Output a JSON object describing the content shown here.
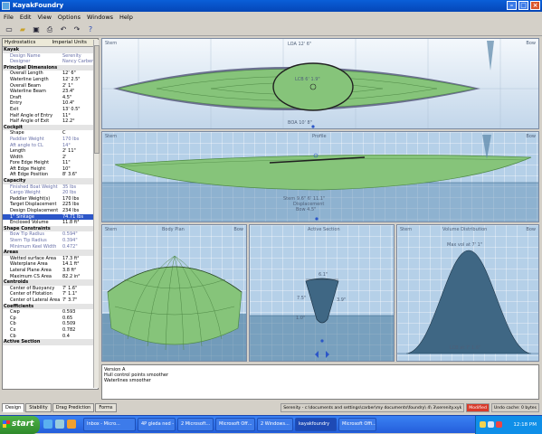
{
  "window": {
    "title": "KayakFoundry"
  },
  "menu": [
    "File",
    "Edit",
    "View",
    "Options",
    "Windows",
    "Help"
  ],
  "toolbar_icons": [
    "new-icon",
    "open-icon",
    "save-icon",
    "print-icon",
    "undo-icon",
    "redo-icon",
    "help-icon"
  ],
  "sidebar": {
    "header_left": "Hydrostatics",
    "header_right": "Imperial Units",
    "rows": [
      {
        "type": "cat",
        "name": "Kayak"
      },
      {
        "name": "Design Name",
        "value": "Serenity",
        "style": "dim"
      },
      {
        "name": "Designer",
        "value": "Nancy Carber",
        "style": "dim"
      },
      {
        "type": "cat",
        "name": "Principal Dimensions"
      },
      {
        "name": "Overall Length",
        "value": "12' 6\""
      },
      {
        "name": "Waterline Length",
        "value": "12' 2.5\""
      },
      {
        "name": "Overall Beam",
        "value": "2' 1\""
      },
      {
        "name": "Waterline Beam",
        "value": "23.4\""
      },
      {
        "name": "Draft",
        "value": "4.5\""
      },
      {
        "name": "Entry",
        "value": "10.4\""
      },
      {
        "name": "Exit",
        "value": "13' 0.5\""
      },
      {
        "name": "Half Angle of Entry",
        "value": "11°"
      },
      {
        "name": "Half Angle of Exit",
        "value": "12.2°"
      },
      {
        "type": "cat",
        "name": "Cockpit"
      },
      {
        "name": "Shape",
        "value": "C"
      },
      {
        "name": "Paddler Weight",
        "value": "170 lbs",
        "style": "dim"
      },
      {
        "name": "Aft angle to CL",
        "value": "14°",
        "style": "dim"
      },
      {
        "name": "Length",
        "value": "2' 11\""
      },
      {
        "name": "Width",
        "value": "2'"
      },
      {
        "name": "Fore Edge Height",
        "value": "11\""
      },
      {
        "name": "Aft Edge Height",
        "value": "10\""
      },
      {
        "name": "Aft Edge Position",
        "value": "8' 3.6\""
      },
      {
        "type": "cat",
        "name": "Capacity"
      },
      {
        "name": "Finished Boat Weight",
        "value": "35 lbs",
        "style": "dim"
      },
      {
        "name": "Cargo Weight",
        "value": "20 lbs",
        "style": "dim"
      },
      {
        "name": "Paddler Weight(s)",
        "value": "170 lbs"
      },
      {
        "name": "Target Displacement",
        "value": "225 lbs"
      },
      {
        "name": "Design Displacement",
        "value": "234 lbs"
      },
      {
        "name": "1\" Sinkage",
        "value": "74.71 lbs",
        "style": "hi"
      },
      {
        "name": "Enclosed Volume",
        "value": "11.8 ft³"
      },
      {
        "type": "cat",
        "name": "Shape Constraints"
      },
      {
        "name": "Bow Tip Radius",
        "value": "0.594\"",
        "style": "dim"
      },
      {
        "name": "Stern Tip Radius",
        "value": "0.394\"",
        "style": "dim"
      },
      {
        "name": "Minimum Keel Width",
        "value": "0.472\"",
        "style": "dim"
      },
      {
        "type": "cat",
        "name": "Areas"
      },
      {
        "name": "Wetted surface Area",
        "value": "17.3 ft²"
      },
      {
        "name": "Waterplane Area",
        "value": "14.1 ft²"
      },
      {
        "name": "Lateral Plane Area",
        "value": "3.8 ft²"
      },
      {
        "name": "Maximum CS Area",
        "value": "82.2 in²"
      },
      {
        "type": "cat",
        "name": "Centroids"
      },
      {
        "name": "Center of Buoyancy",
        "value": "7' 1.6\""
      },
      {
        "name": "Center of Flotation",
        "value": "7' 1.1\""
      },
      {
        "name": "Center of Lateral Area",
        "value": "7' 3.7\""
      },
      {
        "type": "cat",
        "name": "Coefficients"
      },
      {
        "name": "Cwp",
        "value": "0.593"
      },
      {
        "name": "Cp",
        "value": "0.65"
      },
      {
        "name": "Cb",
        "value": "0.509"
      },
      {
        "name": "Cx",
        "value": "0.782"
      },
      {
        "name": "Cb",
        "value": "0.4"
      },
      {
        "type": "cat",
        "name": "Active Section"
      }
    ]
  },
  "views": {
    "plan": {
      "stern": "Stern",
      "bow": "Bow",
      "label_top": "LOA 12' 6\"",
      "label_lcb": "LCB 6' 1.9\"",
      "label_loa": "BOA 10' 8\""
    },
    "profile": {
      "stern": "Stern",
      "title": "Profile",
      "bow": "Bow",
      "label1": "Stern 9.6\" 6' 11.1\"",
      "label2": "Displacement",
      "label3": "Bow 4.5\""
    },
    "body": {
      "stern": "Stern",
      "title": "Body Plan",
      "bow": "Bow"
    },
    "section": {
      "title": "Active Section",
      "dim_top": "6.1\"",
      "dim_mid": "3.9\"",
      "dim_left": "7.5\"",
      "dim_bottom": "1.0\""
    },
    "volume": {
      "stern": "Stern",
      "title": "Volume Distribution",
      "bow": "Bow",
      "label_max": "Max vol at 7' 1\"",
      "label_lcb": "LCB at 7' 1.6\""
    }
  },
  "notes": [
    "Version A",
    "Hull control points smoother",
    "Waterlines smoother"
  ],
  "tabs": [
    "Design",
    "Stability",
    "Drag Prediction",
    "Forms"
  ],
  "status": {
    "path": "Serenity - c:\\documents and settings\\carber\\my documents\\foundry\\ 4\\ 3\\serenity.xyk",
    "flag": "Modified",
    "undo": "Undo cache: 0 bytes"
  },
  "colors": {
    "hull": "#86c47a",
    "hull_dark": "#4f8a46",
    "water": "#3b6f93",
    "grid": "#b5d0e8",
    "volume_fill": "#3f6784",
    "highlight": "#2c56c8"
  },
  "taskbar": {
    "start": "start",
    "tasks": [
      "Inbox - Micro...",
      "4P gleda ned - ...",
      "2 Microsoft...",
      "Microsoft Off...",
      "2 Windows...",
      "kayakfoundry",
      "Microsoft Offi..."
    ],
    "clock": "12:18 PM"
  }
}
